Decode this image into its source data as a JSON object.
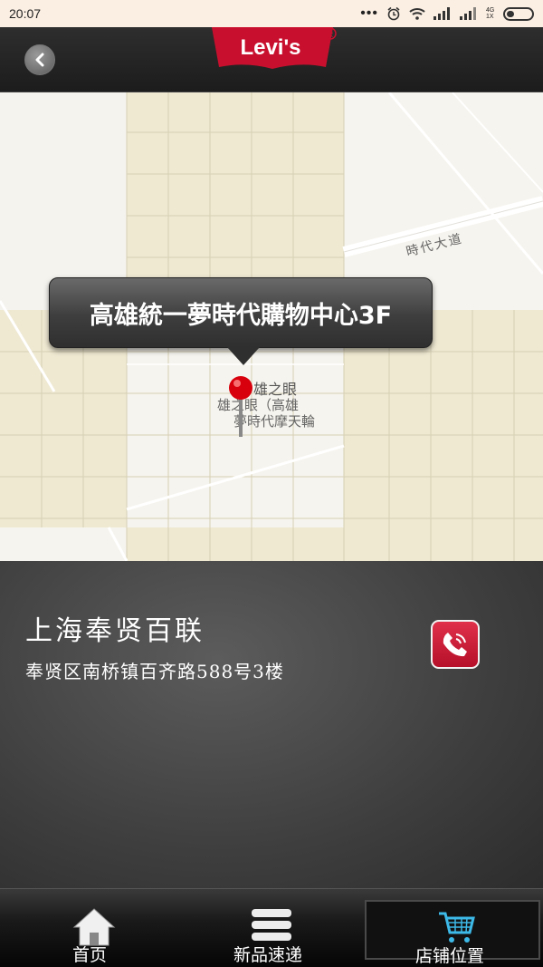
{
  "status_bar": {
    "time": "20:07",
    "network_label_top": "4G",
    "network_label_bottom": "1X"
  },
  "header": {
    "logo_text": "Levi's"
  },
  "map": {
    "callout_title": "高雄統一夢時代購物中心3F",
    "road_label": "時代大道",
    "landmark_label_1": "雄之眼",
    "landmark_label_2": "雄之眼（高雄",
    "landmark_label_3": "夢時代摩天輪"
  },
  "store": {
    "name": "上海奉贤百联",
    "address": "奉贤区南桥镇百齐路588号3楼"
  },
  "tabs": [
    {
      "label": "首页",
      "icon": "home-icon"
    },
    {
      "label": "新品速递",
      "icon": "stack-icon"
    },
    {
      "label": "店铺位置",
      "icon": "cart-icon"
    }
  ],
  "colors": {
    "accent_red": "#c8102e",
    "map_tile": "#efe9d2"
  }
}
